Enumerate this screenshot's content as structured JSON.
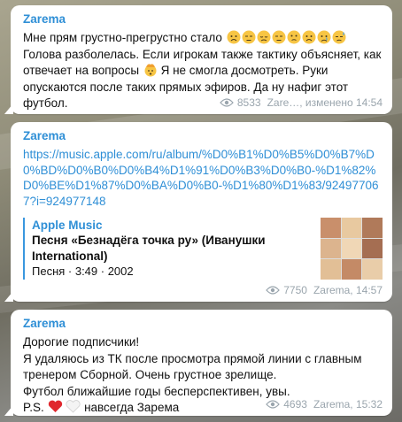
{
  "messages": [
    {
      "author": "Zarema",
      "line1": "Мне прям грустно-прегрустно стало",
      "line2a": "Голова разболелась. Если игрокам также тактику объясняет, как отвечает на вопросы",
      "line2b": "Я не смогла досмотреть. Руки опускаются после таких прямых эфиров. Да ну нафиг этот футбол.",
      "views": "8533",
      "signature": "Zare…, изменено 14:54"
    },
    {
      "author": "Zarema",
      "link": "https://music.apple.com/ru/album/%D0%B1%D0%B5%D0%B7%D0%BD%D0%B0%D0%B4%D1%91%D0%B3%D0%B0-%D1%82%D0%BE%D1%87%D0%BA%D0%B0-%D1%80%D1%83/924977067?i=924977148",
      "preview_site": "Apple Music",
      "preview_title": "Песня «Безнадёга точка ру» (Иванушки International)",
      "preview_desc": "Песня · 3:49 · 2002",
      "views": "7750",
      "signature": "Zarema, 14:57"
    },
    {
      "author": "Zarema",
      "lines": [
        "Дорогие подписчики!",
        "Я удаляюсь из ТК после просмотра прямой линии с главным тренером Сборной. Очень грустное зрелище.",
        "Футбол ближайшие годы бесперспективен, увы."
      ],
      "ps_prefix": "P.S.",
      "ps_suffix": "навсегда Зарема",
      "views": "4693",
      "signature": "Zarema, 15:32"
    }
  ]
}
